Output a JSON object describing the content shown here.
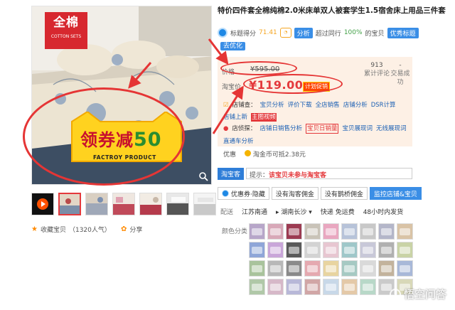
{
  "product": {
    "title": "特价四件套全棉纯棉2.0米床单双人被套学生1.5宿舍床上用品三件套"
  },
  "image_badge": {
    "big": "全棉",
    "small": "COTTON SETS"
  },
  "coupon_banner": {
    "prefix": "领券减",
    "amount": "50",
    "sub": "FACTROY PRODUCT"
  },
  "score": {
    "label": "标题得分",
    "value": "71.41",
    "analyze_btn": "分析",
    "peer_text": "超过同行",
    "peer_pct": "100%",
    "peer_suffix": "的宝贝",
    "excellent_btn": "优秀标题",
    "optimize_btn": "去优化"
  },
  "pricing": {
    "price_label": "价格",
    "old_price": "¥595.00",
    "tb_label": "淘宝价",
    "new_price": "¥119.00",
    "plan_tag": "计划促销",
    "reviews_value": "913",
    "reviews_label": "累计评论",
    "sales_value": "-",
    "sales_label": "交易成功"
  },
  "shop_tools": {
    "row1_prefix": "店铺查：",
    "row1": [
      "宝贝分析",
      "评价下载",
      "全店销售",
      "店铺分析",
      "DSR计算",
      "店铺上新"
    ],
    "row1_tag": "主图视频",
    "row2_prefix": "店侦探：",
    "row2": [
      "店铺日销售分析",
      "宝贝日销量",
      "宝贝展现词",
      "无线展现词",
      "直通车分析"
    ]
  },
  "promo": {
    "label": "优惠",
    "text": "淘金币可抵2.38元"
  },
  "notice": {
    "tag": "淘宝客",
    "prefix": "提示：",
    "text": "该宝贝未参与淘宝客"
  },
  "tabs": [
    "优惠券·隐藏",
    "没有淘客佣金",
    "没有鹊桥佣金",
    "监控店铺&宝贝"
  ],
  "shipping": {
    "label": "配送",
    "from": "江苏南通",
    "to": "湖南长沙",
    "method": "快递 免运费",
    "time": "48小时内发货"
  },
  "color_label": "颜色分类",
  "favorite": {
    "label": "收藏宝贝",
    "count": "（1320人气）"
  },
  "share_label": "分享",
  "watermark": "悟空问答",
  "colors": {
    "price_red": "#e4393c",
    "blue_btn": "#3a8ee6",
    "price_bg": "#fdf0e5",
    "ring_red": "#e53535"
  },
  "swatch_colors": [
    "#b7a6c9",
    "#d8a8b8",
    "#9c3b52",
    "#c9c3b8",
    "#e9a7c0",
    "#b7c3d9",
    "#c8c8c8",
    "#b4b6c9",
    "#d9c3a6",
    "#8fa6d8",
    "#c9a6d9",
    "#5a5a5a",
    "#d3d3d3",
    "#e7c6d1",
    "#9fc7c9",
    "#c8c8d8",
    "#b0b0b0",
    "#c9d3a6",
    "#a9c39c",
    "#b8b8b8",
    "#8a8a8a",
    "#e5a9b0",
    "#e8d4a0",
    "#a6c9c3",
    "#d9d9d9",
    "#c3b39c",
    "#a8b8d8",
    "#b0c8a8",
    "#d6b8c8",
    "#b8b8d8",
    "#d1a6a6",
    "#c8d8e8",
    "#e4c9a8",
    "#b8d8c8",
    "#cacaca",
    "#d8d8b8"
  ]
}
